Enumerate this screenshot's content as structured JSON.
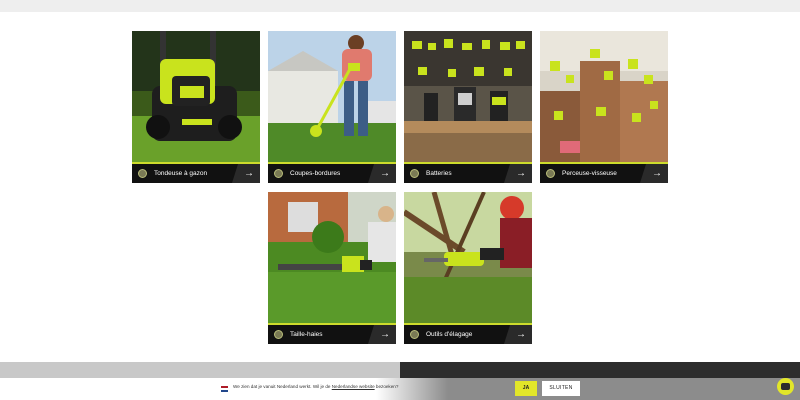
{
  "categories": [
    {
      "label": "Tondeuse à gazon",
      "icon": "lawnmower-icon"
    },
    {
      "label": "Coupes-bordures",
      "icon": "trimmer-icon"
    },
    {
      "label": "Batteries",
      "icon": "battery-icon"
    },
    {
      "label": "Perceuse-visseuse",
      "icon": "drill-icon"
    },
    {
      "label": "Taille-haies",
      "icon": "hedge-trimmer-icon"
    },
    {
      "label": "Outils d'élagage",
      "icon": "pruning-saw-icon"
    }
  ],
  "arrow_glyph": "→",
  "cookie": {
    "message_prefix": "We zien dat je vanuit Nederland werkt. Wil je de ",
    "link_text": "Nederlandse website",
    "message_suffix": " bezoeken?",
    "accept_label": "JA",
    "close_label": "SLUITEN"
  },
  "colors": {
    "accent": "#cddc2c",
    "button_yellow": "#e2e629",
    "card_bar": "#111111",
    "footer_dark": "#2d2d2d"
  }
}
